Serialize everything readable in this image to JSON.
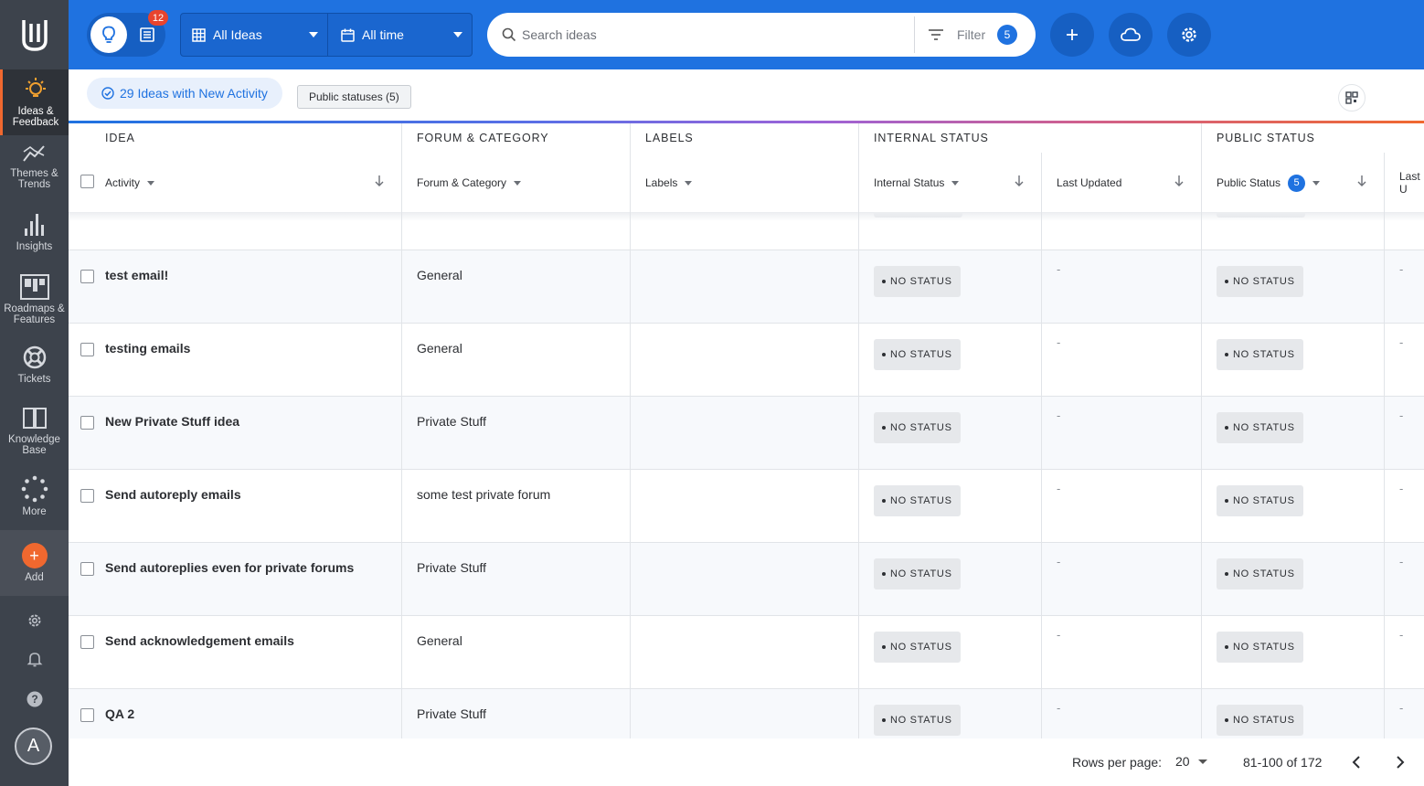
{
  "sidebar": {
    "items": [
      {
        "label_line1": "Ideas &",
        "label_line2": "Feedback",
        "icon": "bulb-icon"
      },
      {
        "label_line1": "Themes &",
        "label_line2": "Trends",
        "icon": "trends-icon"
      },
      {
        "label_line1": "Insights",
        "label_line2": "",
        "icon": "bar-chart-icon"
      },
      {
        "label_line1": "Roadmaps &",
        "label_line2": "Features",
        "icon": "roadmap-icon"
      },
      {
        "label_line1": "Tickets",
        "label_line2": "",
        "icon": "lifebuoy-icon"
      },
      {
        "label_line1": "Knowledge",
        "label_line2": "Base",
        "icon": "book-icon"
      },
      {
        "label_line1": "More",
        "label_line2": "",
        "icon": "dots-circle-icon"
      },
      {
        "label_line1": "Add",
        "label_line2": "",
        "icon": "plus-icon"
      }
    ],
    "avatar_initial": "A"
  },
  "topbar": {
    "notification_count": "12",
    "view_select": "All Ideas",
    "time_select": "All time",
    "search_placeholder": "Search ideas",
    "filter_label": "Filter",
    "filter_count": "5"
  },
  "subbar": {
    "activity_pill": "29 Ideas with New Activity",
    "status_chip": "Public statuses (5)"
  },
  "table": {
    "groups": [
      "IDEA",
      "FORUM & CATEGORY",
      "LABELS",
      "INTERNAL STATUS",
      "PUBLIC STATUS"
    ],
    "columns": {
      "activity": "Activity",
      "forum": "Forum & Category",
      "labels": "Labels",
      "internal_status": "Internal Status",
      "last_updated": "Last Updated",
      "public_status": "Public Status",
      "public_status_count": "5",
      "last_cut": "Last U"
    },
    "rows": [
      {
        "title": "test email!",
        "forum": "General",
        "internal_status": "NO STATUS",
        "last_updated": "-",
        "public_status": "NO STATUS",
        "last": "-"
      },
      {
        "title": "testing emails",
        "forum": "General",
        "internal_status": "NO STATUS",
        "last_updated": "-",
        "public_status": "NO STATUS",
        "last": "-"
      },
      {
        "title": "New Private Stuff idea",
        "forum": "Private Stuff",
        "internal_status": "NO STATUS",
        "last_updated": "-",
        "public_status": "NO STATUS",
        "last": "-"
      },
      {
        "title": "Send autoreply emails",
        "forum": "some test private forum",
        "internal_status": "NO STATUS",
        "last_updated": "-",
        "public_status": "NO STATUS",
        "last": "-"
      },
      {
        "title": "Send autoreplies even for private forums",
        "forum": "Private Stuff",
        "internal_status": "NO STATUS",
        "last_updated": "-",
        "public_status": "NO STATUS",
        "last": "-"
      },
      {
        "title": "Send acknowledgement emails",
        "forum": "General",
        "internal_status": "NO STATUS",
        "last_updated": "-",
        "public_status": "NO STATUS",
        "last": "-"
      },
      {
        "title": "QA 2",
        "forum": "Private Stuff",
        "internal_status": "NO STATUS",
        "last_updated": "-",
        "public_status": "NO STATUS",
        "last": "-"
      }
    ]
  },
  "footer": {
    "rows_per_page_label": "Rows per page:",
    "rows_per_page_value": "20",
    "range": "81-100 of 172"
  },
  "colors": {
    "primary": "#1f72e0",
    "sidebar": "#3d434c",
    "accent": "#f0682f",
    "alert": "#e8442e"
  }
}
